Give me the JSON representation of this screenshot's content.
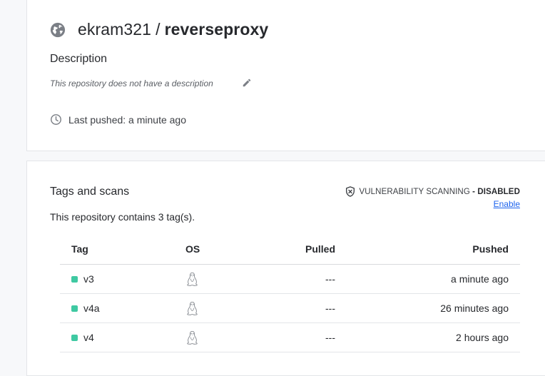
{
  "repo": {
    "icon": "globe-icon",
    "owner": "ekram321",
    "separator": "/",
    "name": "reverseproxy",
    "description_heading": "Description",
    "description_text": "This repository does not have a description",
    "last_pushed": "Last pushed: a minute ago"
  },
  "tags": {
    "heading": "Tags and scans",
    "vuln_label": "VULNERABILITY SCANNING",
    "vuln_sep": " - ",
    "vuln_state": "DISABLED",
    "enable_link": "Enable",
    "count_text": "This repository contains 3 tag(s).",
    "columns": [
      "Tag",
      "OS",
      "Pulled",
      "Pushed"
    ],
    "rows": [
      {
        "tag": "v3",
        "os": "linux-icon",
        "pulled": "---",
        "pushed": "a minute ago"
      },
      {
        "tag": "v4a",
        "os": "linux-icon",
        "pulled": "---",
        "pushed": "26 minutes ago"
      },
      {
        "tag": "v4",
        "os": "linux-icon",
        "pulled": "---",
        "pushed": "2 hours ago"
      }
    ]
  },
  "colors": {
    "accent_link": "#1d63ed",
    "tag_status": "#3fc9a2",
    "icon_gray": "#7b7f86"
  }
}
